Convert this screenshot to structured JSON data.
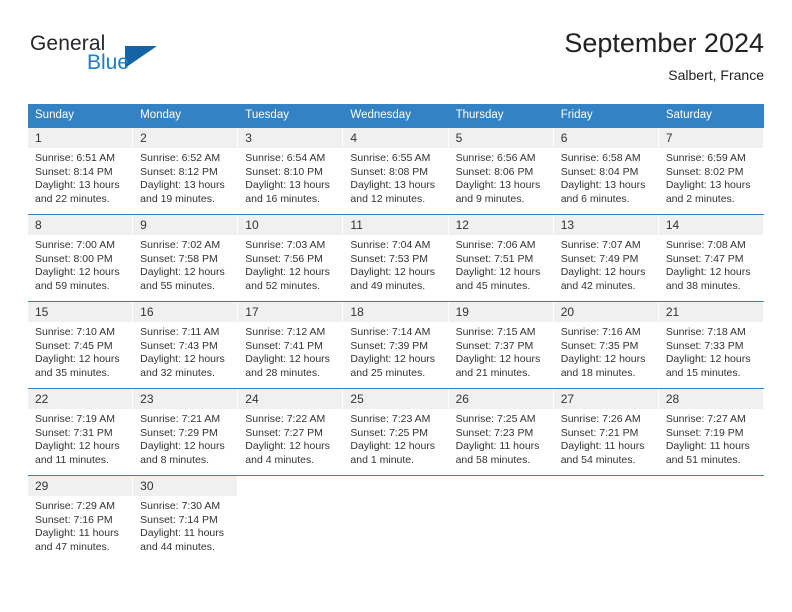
{
  "brand": {
    "name_part1": "General",
    "name_part2": "Blue",
    "triangle_icon": "triangle-icon",
    "accent_color": "#1c7ec4",
    "triangle_color": "#1464a5"
  },
  "header": {
    "title": "September 2024",
    "location": "Salbert, France"
  },
  "calendar": {
    "header_bg_color": "#3282c4",
    "day_band_color": "#f0f0f0",
    "weekdays": [
      "Sunday",
      "Monday",
      "Tuesday",
      "Wednesday",
      "Thursday",
      "Friday",
      "Saturday"
    ],
    "weeks": [
      [
        {
          "day": "1",
          "sunrise": "Sunrise: 6:51 AM",
          "sunset": "Sunset: 8:14 PM",
          "daylight1": "Daylight: 13 hours",
          "daylight2": "and 22 minutes."
        },
        {
          "day": "2",
          "sunrise": "Sunrise: 6:52 AM",
          "sunset": "Sunset: 8:12 PM",
          "daylight1": "Daylight: 13 hours",
          "daylight2": "and 19 minutes."
        },
        {
          "day": "3",
          "sunrise": "Sunrise: 6:54 AM",
          "sunset": "Sunset: 8:10 PM",
          "daylight1": "Daylight: 13 hours",
          "daylight2": "and 16 minutes."
        },
        {
          "day": "4",
          "sunrise": "Sunrise: 6:55 AM",
          "sunset": "Sunset: 8:08 PM",
          "daylight1": "Daylight: 13 hours",
          "daylight2": "and 12 minutes."
        },
        {
          "day": "5",
          "sunrise": "Sunrise: 6:56 AM",
          "sunset": "Sunset: 8:06 PM",
          "daylight1": "Daylight: 13 hours",
          "daylight2": "and 9 minutes."
        },
        {
          "day": "6",
          "sunrise": "Sunrise: 6:58 AM",
          "sunset": "Sunset: 8:04 PM",
          "daylight1": "Daylight: 13 hours",
          "daylight2": "and 6 minutes."
        },
        {
          "day": "7",
          "sunrise": "Sunrise: 6:59 AM",
          "sunset": "Sunset: 8:02 PM",
          "daylight1": "Daylight: 13 hours",
          "daylight2": "and 2 minutes."
        }
      ],
      [
        {
          "day": "8",
          "sunrise": "Sunrise: 7:00 AM",
          "sunset": "Sunset: 8:00 PM",
          "daylight1": "Daylight: 12 hours",
          "daylight2": "and 59 minutes."
        },
        {
          "day": "9",
          "sunrise": "Sunrise: 7:02 AM",
          "sunset": "Sunset: 7:58 PM",
          "daylight1": "Daylight: 12 hours",
          "daylight2": "and 55 minutes."
        },
        {
          "day": "10",
          "sunrise": "Sunrise: 7:03 AM",
          "sunset": "Sunset: 7:56 PM",
          "daylight1": "Daylight: 12 hours",
          "daylight2": "and 52 minutes."
        },
        {
          "day": "11",
          "sunrise": "Sunrise: 7:04 AM",
          "sunset": "Sunset: 7:53 PM",
          "daylight1": "Daylight: 12 hours",
          "daylight2": "and 49 minutes."
        },
        {
          "day": "12",
          "sunrise": "Sunrise: 7:06 AM",
          "sunset": "Sunset: 7:51 PM",
          "daylight1": "Daylight: 12 hours",
          "daylight2": "and 45 minutes."
        },
        {
          "day": "13",
          "sunrise": "Sunrise: 7:07 AM",
          "sunset": "Sunset: 7:49 PM",
          "daylight1": "Daylight: 12 hours",
          "daylight2": "and 42 minutes."
        },
        {
          "day": "14",
          "sunrise": "Sunrise: 7:08 AM",
          "sunset": "Sunset: 7:47 PM",
          "daylight1": "Daylight: 12 hours",
          "daylight2": "and 38 minutes."
        }
      ],
      [
        {
          "day": "15",
          "sunrise": "Sunrise: 7:10 AM",
          "sunset": "Sunset: 7:45 PM",
          "daylight1": "Daylight: 12 hours",
          "daylight2": "and 35 minutes."
        },
        {
          "day": "16",
          "sunrise": "Sunrise: 7:11 AM",
          "sunset": "Sunset: 7:43 PM",
          "daylight1": "Daylight: 12 hours",
          "daylight2": "and 32 minutes."
        },
        {
          "day": "17",
          "sunrise": "Sunrise: 7:12 AM",
          "sunset": "Sunset: 7:41 PM",
          "daylight1": "Daylight: 12 hours",
          "daylight2": "and 28 minutes."
        },
        {
          "day": "18",
          "sunrise": "Sunrise: 7:14 AM",
          "sunset": "Sunset: 7:39 PM",
          "daylight1": "Daylight: 12 hours",
          "daylight2": "and 25 minutes."
        },
        {
          "day": "19",
          "sunrise": "Sunrise: 7:15 AM",
          "sunset": "Sunset: 7:37 PM",
          "daylight1": "Daylight: 12 hours",
          "daylight2": "and 21 minutes."
        },
        {
          "day": "20",
          "sunrise": "Sunrise: 7:16 AM",
          "sunset": "Sunset: 7:35 PM",
          "daylight1": "Daylight: 12 hours",
          "daylight2": "and 18 minutes."
        },
        {
          "day": "21",
          "sunrise": "Sunrise: 7:18 AM",
          "sunset": "Sunset: 7:33 PM",
          "daylight1": "Daylight: 12 hours",
          "daylight2": "and 15 minutes."
        }
      ],
      [
        {
          "day": "22",
          "sunrise": "Sunrise: 7:19 AM",
          "sunset": "Sunset: 7:31 PM",
          "daylight1": "Daylight: 12 hours",
          "daylight2": "and 11 minutes."
        },
        {
          "day": "23",
          "sunrise": "Sunrise: 7:21 AM",
          "sunset": "Sunset: 7:29 PM",
          "daylight1": "Daylight: 12 hours",
          "daylight2": "and 8 minutes."
        },
        {
          "day": "24",
          "sunrise": "Sunrise: 7:22 AM",
          "sunset": "Sunset: 7:27 PM",
          "daylight1": "Daylight: 12 hours",
          "daylight2": "and 4 minutes."
        },
        {
          "day": "25",
          "sunrise": "Sunrise: 7:23 AM",
          "sunset": "Sunset: 7:25 PM",
          "daylight1": "Daylight: 12 hours",
          "daylight2": "and 1 minute."
        },
        {
          "day": "26",
          "sunrise": "Sunrise: 7:25 AM",
          "sunset": "Sunset: 7:23 PM",
          "daylight1": "Daylight: 11 hours",
          "daylight2": "and 58 minutes."
        },
        {
          "day": "27",
          "sunrise": "Sunrise: 7:26 AM",
          "sunset": "Sunset: 7:21 PM",
          "daylight1": "Daylight: 11 hours",
          "daylight2": "and 54 minutes."
        },
        {
          "day": "28",
          "sunrise": "Sunrise: 7:27 AM",
          "sunset": "Sunset: 7:19 PM",
          "daylight1": "Daylight: 11 hours",
          "daylight2": "and 51 minutes."
        }
      ],
      [
        {
          "day": "29",
          "sunrise": "Sunrise: 7:29 AM",
          "sunset": "Sunset: 7:16 PM",
          "daylight1": "Daylight: 11 hours",
          "daylight2": "and 47 minutes."
        },
        {
          "day": "30",
          "sunrise": "Sunrise: 7:30 AM",
          "sunset": "Sunset: 7:14 PM",
          "daylight1": "Daylight: 11 hours",
          "daylight2": "and 44 minutes."
        },
        {
          "day": "",
          "sunrise": "",
          "sunset": "",
          "daylight1": "",
          "daylight2": ""
        },
        {
          "day": "",
          "sunrise": "",
          "sunset": "",
          "daylight1": "",
          "daylight2": ""
        },
        {
          "day": "",
          "sunrise": "",
          "sunset": "",
          "daylight1": "",
          "daylight2": ""
        },
        {
          "day": "",
          "sunrise": "",
          "sunset": "",
          "daylight1": "",
          "daylight2": ""
        },
        {
          "day": "",
          "sunrise": "",
          "sunset": "",
          "daylight1": "",
          "daylight2": ""
        }
      ]
    ]
  }
}
